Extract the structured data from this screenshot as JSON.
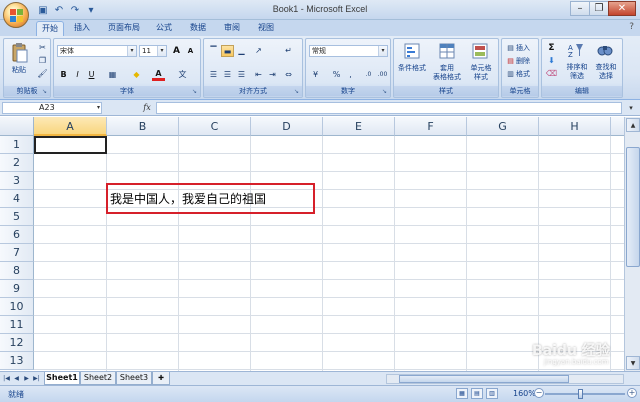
{
  "window": {
    "title": "Book1 - Microsoft Excel",
    "minimize": "–",
    "restore": "❐",
    "close": "✕"
  },
  "qat": {
    "save": "▣",
    "undo": "↶",
    "redo": "↷",
    "more": "▾"
  },
  "ribbon_tabs": [
    "开始",
    "插入",
    "页面布局",
    "公式",
    "数据",
    "审阅",
    "视图"
  ],
  "active_tab": "开始",
  "help": "?",
  "clipboard": {
    "paste": "粘贴",
    "label": "剪贴板"
  },
  "font": {
    "name": "宋体",
    "size": "11",
    "grow": "A",
    "shrink": "A",
    "bold": "B",
    "italic": "I",
    "underline": "U",
    "font_color": "A",
    "fill": "◆",
    "border": "▦",
    "phonetic": "文",
    "label": "字体"
  },
  "alignment": {
    "label": "对齐方式"
  },
  "number": {
    "format": "常规",
    "percent": "%",
    "comma": ",",
    "label": "数字"
  },
  "styles": {
    "conditional": "条件格式",
    "table": "套用\n表格格式",
    "cell_styles": "单元格\n样式",
    "label": "样式"
  },
  "cells": {
    "insert": "插入",
    "delete": "删除",
    "format": "格式",
    "label": "单元格"
  },
  "editing": {
    "sum": "Σ",
    "sort": "排序和\n筛选",
    "find": "查找和\n选择",
    "label": "编辑"
  },
  "formula_bar": {
    "name_box": "A23",
    "fx": "fx",
    "value": ""
  },
  "columns": [
    "A",
    "B",
    "C",
    "D",
    "E",
    "F",
    "G",
    "H"
  ],
  "rows": [
    "1",
    "2",
    "3",
    "4",
    "5",
    "6",
    "7",
    "8",
    "9",
    "10",
    "11",
    "12",
    "13"
  ],
  "cell_content": "我是中国人，我爱自己的祖国",
  "sheets": [
    "Sheet1",
    "Sheet2",
    "Sheet3"
  ],
  "active_sheet": "Sheet1",
  "status": {
    "ready": "就绪",
    "zoom": "160%"
  },
  "watermark": {
    "main": "Baidu 经验",
    "sub": "jingyan.baidu.com"
  },
  "colors": {
    "highlight": "#d6202a",
    "ribbon": "#dbe6f4",
    "accent": "#15428b"
  }
}
